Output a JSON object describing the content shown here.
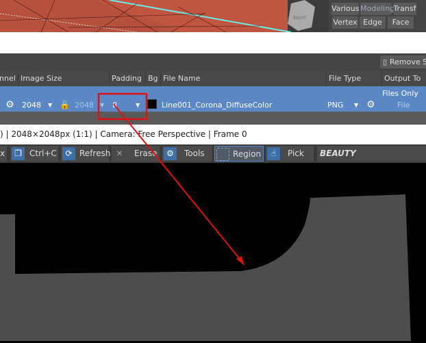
{
  "viewcube_label": "RIGHT",
  "command_panel": {
    "buttons_row1": [
      "Various",
      "Modeling",
      "Transf"
    ],
    "buttons_row2": [
      "Vertex",
      "Edge",
      "Face"
    ]
  },
  "remove_button": "Remove Se",
  "table": {
    "headers": [
      "nnel",
      "Image Size",
      "Padding",
      "Bg",
      "File Name",
      "File Type",
      "Output To"
    ],
    "row": {
      "width": "2048",
      "height": "2048",
      "padding": "8",
      "bg_color": "#000000",
      "file_name": "Line001_Corona_DiffuseColor",
      "file_type": "PNG",
      "output_to": "Files Only",
      "output_to_value": "File Only"
    }
  },
  "status_text": ") | 2048×2048px (1:1) | Camera: Free Perspective | Frame 0",
  "toolbar": {
    "items": [
      "x",
      "Ctrl+C",
      "Refresh",
      "Erase",
      "Tools",
      "Region",
      "Pick"
    ],
    "channel": "BEAUTY"
  },
  "colors": {
    "selected_row": "#5b88c4",
    "annotation": "#e01010",
    "mesh": "#c0503c"
  }
}
